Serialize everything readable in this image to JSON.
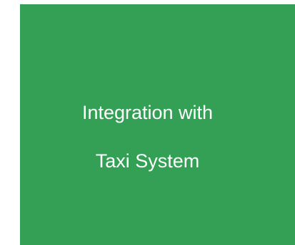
{
  "block": {
    "label_line1": "Integration with",
    "label_line2": "Taxi System",
    "fill_color": "#33a055",
    "text_color": "#ffffff"
  }
}
